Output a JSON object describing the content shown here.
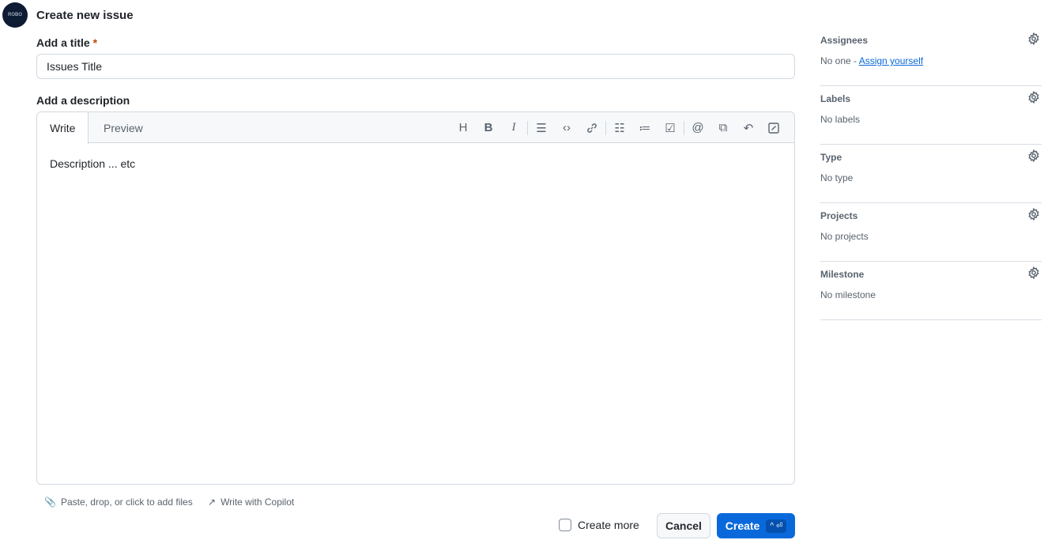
{
  "header": {
    "avatar_text": "ROBO",
    "title": "Create new issue"
  },
  "form": {
    "title_label": "Add a title",
    "required_mark": "*",
    "title_value": "Issues Title",
    "desc_label": "Add a description",
    "tabs": [
      "Write",
      "Preview"
    ],
    "description": "Description ... etc",
    "attach_hint": "Paste, drop, or click to add files",
    "copilot": "Write with Copilot",
    "create_more": "Create more",
    "cancel": "Cancel",
    "create": "Create",
    "create_shortcut": "^ ⏎"
  },
  "sidebar": [
    {
      "heading": "Assignees",
      "value": "No one - ",
      "link": "Assign yourself"
    },
    {
      "heading": "Labels",
      "value": "No labels"
    },
    {
      "heading": "Type",
      "value": "No type"
    },
    {
      "heading": "Projects",
      "value": "No projects"
    },
    {
      "heading": "Milestone",
      "value": "No milestone"
    }
  ],
  "colors": {
    "primary": "#0969da",
    "required": "#bc4c00"
  }
}
